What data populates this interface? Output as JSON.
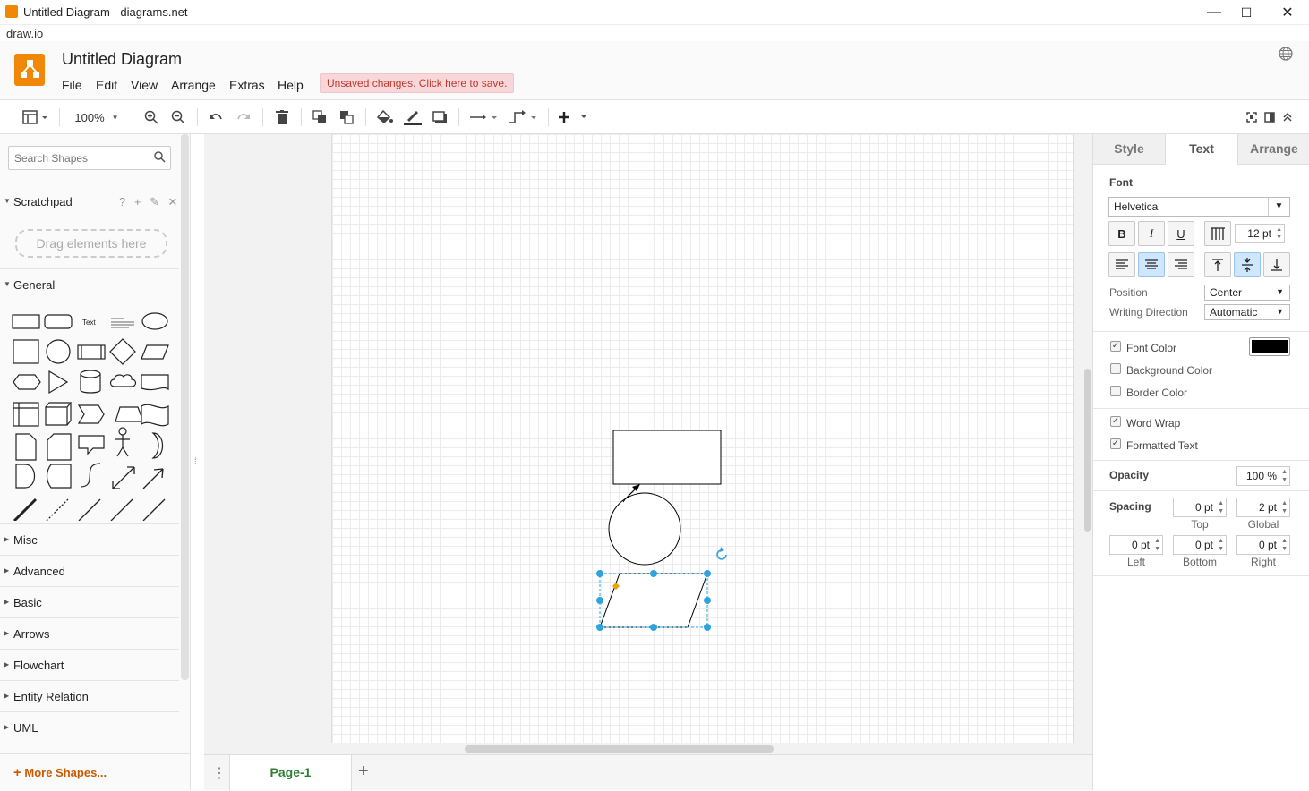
{
  "window": {
    "title": "Untitled Diagram - diagrams.net",
    "subtitle": "draw.io",
    "minimize": "—",
    "maximize": "☐",
    "close": "✕"
  },
  "header": {
    "title": "Untitled Diagram",
    "menu": [
      "File",
      "Edit",
      "View",
      "Arrange",
      "Extras",
      "Help"
    ],
    "unsaved": "Unsaved changes. Click here to save."
  },
  "toolbar": {
    "zoom": "100%"
  },
  "left": {
    "search_placeholder": "Search Shapes",
    "scratchpad": "Scratchpad",
    "scratch_icons": "? + ✎ ✕",
    "drag": "Drag elements here",
    "general": "General",
    "text_shape": "Text",
    "sections": [
      "Misc",
      "Advanced",
      "Basic",
      "Arrows",
      "Flowchart",
      "Entity Relation",
      "UML"
    ],
    "more_shapes": "More Shapes..."
  },
  "bottom": {
    "page_tab": "Page-1",
    "add": "+",
    "menu": "⋮"
  },
  "right": {
    "tabs": [
      "Style",
      "Text",
      "Arrange"
    ],
    "font_label": "Font",
    "font": "Helvetica",
    "bold": "B",
    "italic": "I",
    "underline": "U",
    "font_size": "12 pt",
    "position_label": "Position",
    "position": "Center",
    "writing_label": "Writing Direction",
    "writing": "Automatic",
    "font_color": "Font Color",
    "background_color": "Background Color",
    "border_color": "Border Color",
    "word_wrap": "Word Wrap",
    "formatted_text": "Formatted Text",
    "opacity_label": "Opacity",
    "opacity": "100 %",
    "spacing_label": "Spacing",
    "top": "0 pt",
    "top_label": "Top",
    "global": "2 pt",
    "global_label": "Global",
    "left": "0 pt",
    "left_label": "Left",
    "bottom": "0 pt",
    "bottom_label": "Bottom",
    "right": "0 pt",
    "right_label": "Right",
    "accent": "#2ea3e0",
    "font_color_value": "#000000"
  }
}
